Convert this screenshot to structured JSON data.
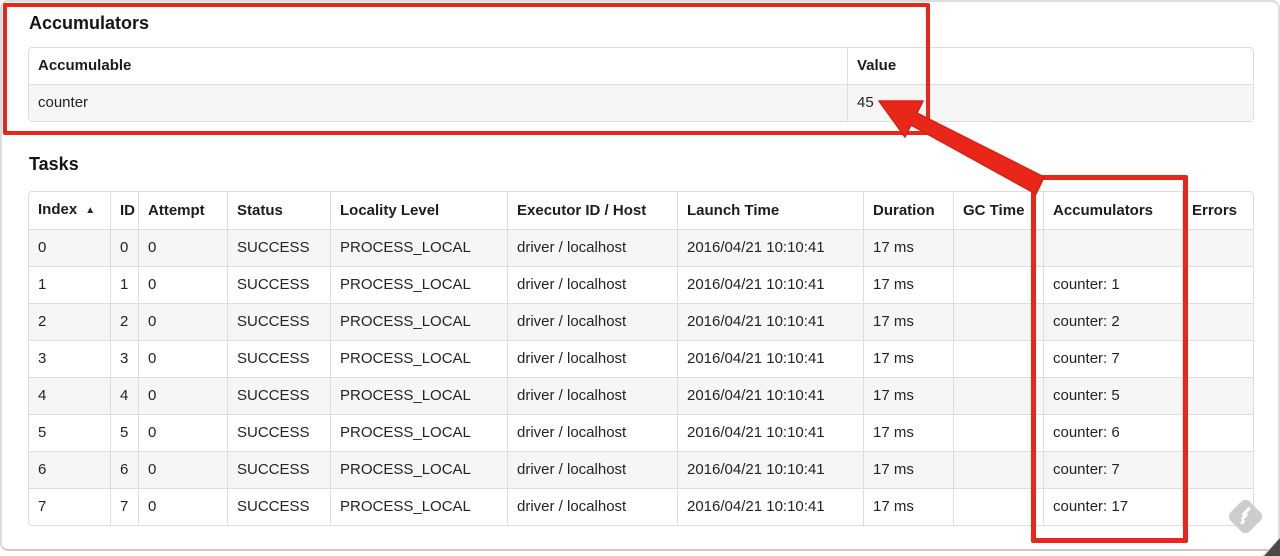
{
  "annotation_color": "#e8271a",
  "accumulators_section": {
    "title": "Accumulators",
    "table": {
      "headers": [
        "Accumulable",
        "Value"
      ],
      "rows": [
        [
          "counter",
          "45"
        ]
      ]
    }
  },
  "tasks_section": {
    "title": "Tasks",
    "table": {
      "headers": [
        "Index",
        "ID",
        "Attempt",
        "Status",
        "Locality Level",
        "Executor ID / Host",
        "Launch Time",
        "Duration",
        "GC Time",
        "Accumulators",
        "Errors"
      ],
      "sort_indicator": "▲",
      "rows": [
        [
          "0",
          "0",
          "0",
          "SUCCESS",
          "PROCESS_LOCAL",
          "driver / localhost",
          "2016/04/21 10:10:41",
          "17 ms",
          "",
          "",
          ""
        ],
        [
          "1",
          "1",
          "0",
          "SUCCESS",
          "PROCESS_LOCAL",
          "driver / localhost",
          "2016/04/21 10:10:41",
          "17 ms",
          "",
          "counter: 1",
          ""
        ],
        [
          "2",
          "2",
          "0",
          "SUCCESS",
          "PROCESS_LOCAL",
          "driver / localhost",
          "2016/04/21 10:10:41",
          "17 ms",
          "",
          "counter: 2",
          ""
        ],
        [
          "3",
          "3",
          "0",
          "SUCCESS",
          "PROCESS_LOCAL",
          "driver / localhost",
          "2016/04/21 10:10:41",
          "17 ms",
          "",
          "counter: 7",
          ""
        ],
        [
          "4",
          "4",
          "0",
          "SUCCESS",
          "PROCESS_LOCAL",
          "driver / localhost",
          "2016/04/21 10:10:41",
          "17 ms",
          "",
          "counter: 5",
          ""
        ],
        [
          "5",
          "5",
          "0",
          "SUCCESS",
          "PROCESS_LOCAL",
          "driver / localhost",
          "2016/04/21 10:10:41",
          "17 ms",
          "",
          "counter: 6",
          ""
        ],
        [
          "6",
          "6",
          "0",
          "SUCCESS",
          "PROCESS_LOCAL",
          "driver / localhost",
          "2016/04/21 10:10:41",
          "17 ms",
          "",
          "counter: 7",
          ""
        ],
        [
          "7",
          "7",
          "0",
          "SUCCESS",
          "PROCESS_LOCAL",
          "driver / localhost",
          "2016/04/21 10:10:41",
          "17 ms",
          "",
          "counter: 17",
          ""
        ]
      ]
    }
  }
}
